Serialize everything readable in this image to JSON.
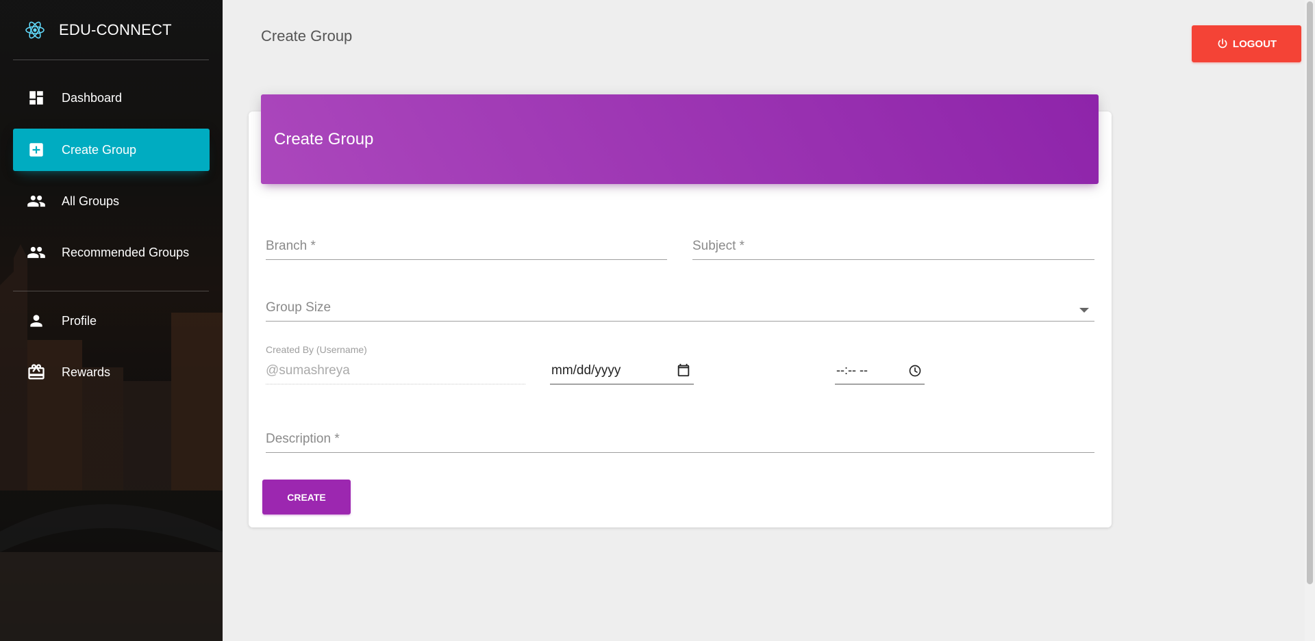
{
  "sidebar": {
    "brand": "EDU-CONNECT",
    "items": [
      {
        "label": "Dashboard",
        "icon": "dashboard-icon"
      },
      {
        "label": "Create Group",
        "icon": "add-box-icon",
        "active": true
      },
      {
        "label": "All Groups",
        "icon": "people-icon"
      },
      {
        "label": "Recommended Groups",
        "icon": "people-icon"
      },
      {
        "label": "Profile",
        "icon": "person-icon"
      },
      {
        "label": "Rewards",
        "icon": "card-giftcard-icon"
      }
    ]
  },
  "header": {
    "title": "Create Group",
    "logout_label": "LOGOUT"
  },
  "card": {
    "title": "Create Group",
    "fields": {
      "branch": "Branch *",
      "subject": "Subject *",
      "group_size": "Group Size",
      "created_by_label": "Created By (Username)",
      "created_by_value": "@sumashreya",
      "date_placeholder": "mm/dd/yyyy",
      "time_placeholder": "--:-- --",
      "description": "Description *"
    },
    "create_label": "CREATE"
  },
  "colors": {
    "accent_active": "#00acc1",
    "header_gradient_start": "#ab47bc",
    "header_gradient_end": "#8e24aa",
    "primary_button": "#9c27b0",
    "logout_button": "#f44336"
  }
}
